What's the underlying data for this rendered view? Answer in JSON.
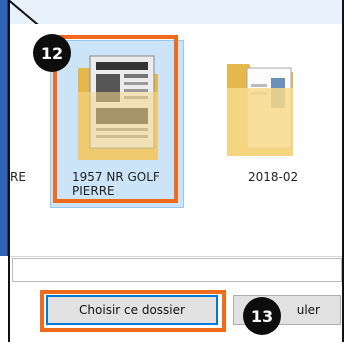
{
  "badges": {
    "step12": "12",
    "step13": "13"
  },
  "folders": [
    {
      "label": "RE",
      "partial": true
    },
    {
      "label": "1957 NR GOLF PIERRE",
      "selected": true,
      "icon": "newspaper-folder-icon"
    },
    {
      "label": "2018-02",
      "icon": "folder-icon"
    }
  ],
  "buttons": {
    "choose": "Choisir ce dossier",
    "cancel_visible": "uler"
  },
  "colors": {
    "highlight": "#f26a1b",
    "selection_bg": "#cce4f7",
    "primary_border": "#0078d7",
    "folder": "#f4d374"
  }
}
